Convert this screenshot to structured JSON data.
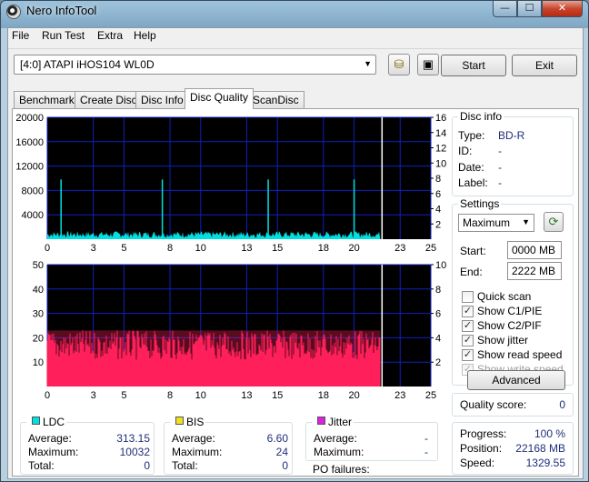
{
  "window": {
    "title": "Nero InfoTool",
    "min": "—",
    "max": "☐",
    "close": "✕"
  },
  "menu": [
    "File",
    "Run Test",
    "Extra",
    "Help"
  ],
  "toolbar": {
    "drive": "[4:0]   ATAPI iHOS104 WL0D",
    "start_label": "Start",
    "exit_label": "Exit"
  },
  "tabs": [
    "Benchmark",
    "Create Disc",
    "Disc Info",
    "Disc Quality",
    "ScanDisc"
  ],
  "active_tab": "Disc Quality",
  "disc_info": {
    "title": "Disc info",
    "type_label": "Type:",
    "type_value": "BD-R",
    "id_label": "ID:",
    "id_value": "-",
    "date_label": "Date:",
    "date_value": "-",
    "label_label": "Label:",
    "label_value": "-"
  },
  "settings": {
    "title": "Settings",
    "speed": "Maximum",
    "start_label": "Start:",
    "start_value": "0000 MB",
    "end_label": "End:",
    "end_value": "2222 MB",
    "checks": [
      {
        "label": "Quick scan",
        "checked": false,
        "disabled": false
      },
      {
        "label": "Show C1/PIE",
        "checked": true,
        "disabled": false
      },
      {
        "label": "Show C2/PIF",
        "checked": true,
        "disabled": false
      },
      {
        "label": "Show jitter",
        "checked": true,
        "disabled": false
      },
      {
        "label": "Show read speed",
        "checked": true,
        "disabled": false
      },
      {
        "label": "Show write speed",
        "checked": true,
        "disabled": true
      }
    ],
    "advanced_label": "Advanced"
  },
  "quality": {
    "label": "Quality score:",
    "value": "0"
  },
  "progress": {
    "progress_label": "Progress:",
    "progress_value": "100 %",
    "position_label": "Position:",
    "position_value": "22168 MB",
    "speed_label": "Speed:",
    "speed_value": "1329.55"
  },
  "ldc": {
    "title": "LDC",
    "color": "#00e0e0",
    "avg_label": "Average:",
    "avg": "313.15",
    "max_label": "Maximum:",
    "max": "10032",
    "total_label": "Total:",
    "total": "0"
  },
  "bis": {
    "title": "BIS",
    "color": "#f0e020",
    "avg_label": "Average:",
    "avg": "6.60",
    "max_label": "Maximum:",
    "max": "24",
    "total_label": "Total:",
    "total": "0"
  },
  "jitter": {
    "title": "Jitter",
    "color": "#e020e0",
    "avg_label": "Average:",
    "avg": "-",
    "max_label": "Maximum:",
    "max": "-",
    "po_label": "PO failures:",
    "po": ""
  },
  "chart_data": [
    {
      "type": "bar",
      "name": "LDC",
      "x_ticks": [
        0,
        3,
        5,
        8,
        10,
        13,
        15,
        18,
        20,
        23,
        25
      ],
      "y_left_ticks": [
        4000,
        8000,
        12000,
        16000,
        20000
      ],
      "y_left_tick_labels": [
        "4000",
        "8000",
        "12000",
        "16000",
        "20000"
      ],
      "y_right_ticks": [
        2,
        4,
        6,
        8,
        10,
        12,
        14,
        16
      ],
      "xlim": [
        0,
        25
      ],
      "ylim": [
        0,
        20000
      ],
      "data_end_x": 21.7,
      "cursor_x": 21.7,
      "baseline": 1200,
      "spikes": [
        {
          "x": 0.9,
          "y": 9800
        },
        {
          "x": 7.5,
          "y": 9800
        },
        {
          "x": 14.4,
          "y": 9800
        },
        {
          "x": 20.0,
          "y": 9800
        }
      ],
      "color": "#00e0e0",
      "background": "#000000",
      "grid_color": "#1020c0"
    },
    {
      "type": "bar",
      "name": "BIS",
      "x_ticks": [
        0,
        3,
        5,
        8,
        10,
        13,
        15,
        18,
        20,
        23,
        25
      ],
      "y_left_ticks": [
        10,
        20,
        30,
        40,
        50
      ],
      "y_right_ticks": [
        2,
        4,
        6,
        8,
        10
      ],
      "xlim": [
        0,
        25
      ],
      "ylim": [
        0,
        50
      ],
      "data_end_x": 21.7,
      "cursor_x": 21.7,
      "band_top": 23,
      "band_bottom": 3,
      "color": "#ff1f5a",
      "background": "#000000",
      "grid_color": "#1020c0"
    }
  ]
}
